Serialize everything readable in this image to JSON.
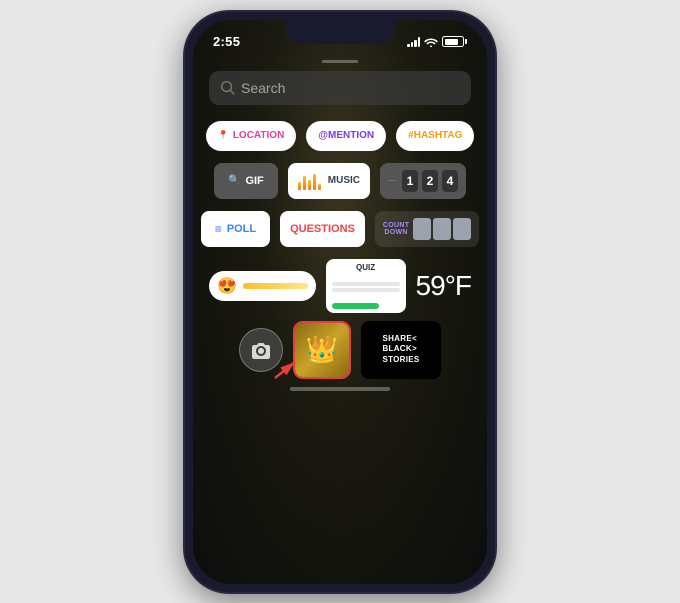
{
  "phone": {
    "time": "2:55",
    "search": {
      "placeholder": "Search"
    },
    "handle_bar_visible": true
  },
  "stickers": {
    "row1": [
      {
        "id": "location",
        "label": "LOCATION",
        "icon": "📍",
        "color": "#e040a0"
      },
      {
        "id": "mention",
        "label": "@MENTION",
        "color": "#7c3aed"
      },
      {
        "id": "hashtag",
        "label": "#HASHTAG",
        "color": "#f59e0b"
      }
    ],
    "row2": [
      {
        "id": "gif",
        "label": "GIF",
        "icon": "🔍"
      },
      {
        "id": "music",
        "label": "MUSIC"
      },
      {
        "id": "counter",
        "digits": [
          "1",
          "2",
          "4"
        ]
      }
    ],
    "row3": [
      {
        "id": "poll",
        "label": "POLL"
      },
      {
        "id": "questions",
        "label": "QUESTIONS"
      },
      {
        "id": "countdown",
        "label": "COUNTDOWN"
      }
    ],
    "row4": [
      {
        "id": "emoji-slider",
        "emoji": "😍"
      },
      {
        "id": "quiz",
        "label": "QUIZ"
      },
      {
        "id": "temperature",
        "label": "59°F"
      }
    ],
    "row5": [
      {
        "id": "camera"
      },
      {
        "id": "crown",
        "highlighted": true
      },
      {
        "id": "share-black-stories",
        "text": "SHARE\nBLACK\nSTORIES"
      }
    ]
  }
}
